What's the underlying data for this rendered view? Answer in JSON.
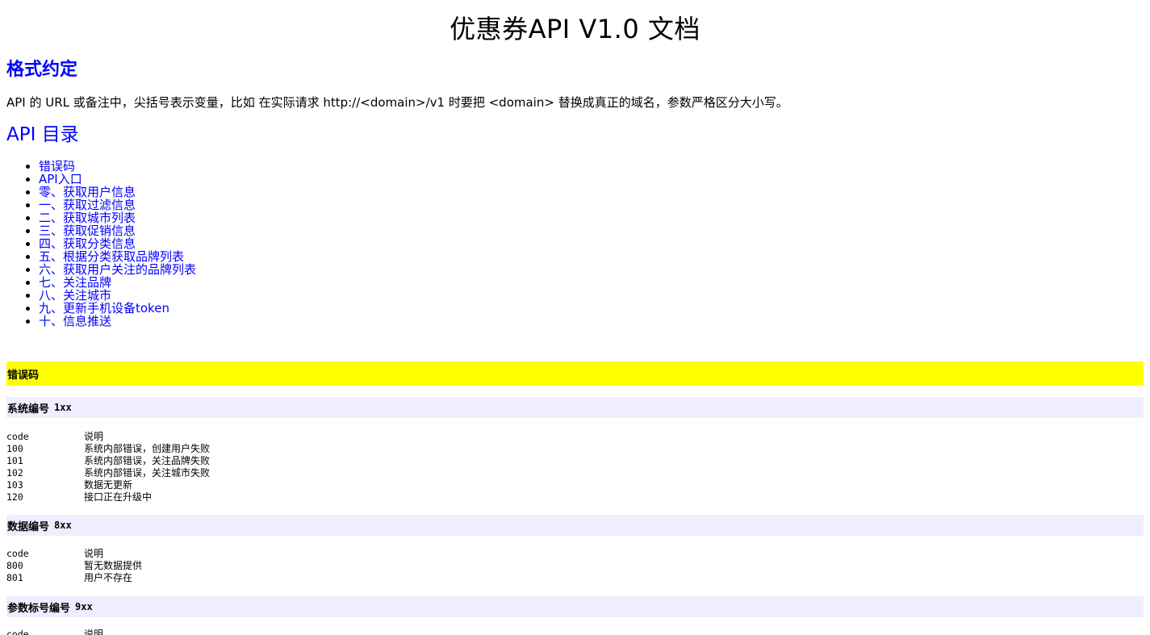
{
  "doc": {
    "title": "优惠券API V1.0 文档"
  },
  "format": {
    "heading": "格式约定",
    "text": "API 的 URL 或备注中，尖括号表示变量，比如 在实际请求 http://<domain>/v1 时要把 <domain> 替换成真正的域名，参数严格区分大小写。"
  },
  "toc": {
    "heading": "API 目录",
    "items": [
      "错误码",
      "API入口",
      "零、获取用户信息",
      "一、获取过滤信息",
      "二、获取城市列表",
      "三、获取促销信息",
      "四、获取分类信息",
      "五、根据分类获取品牌列表",
      "六、获取用户关注的品牌列表",
      "七、关注品牌",
      "八、关注城市",
      "九、更新手机设备token",
      "十、信息推送"
    ]
  },
  "errors": {
    "heading": "错误码",
    "groups": [
      {
        "label": "系统编号",
        "code": "1xx",
        "header": [
          "code",
          "说明"
        ],
        "rows": [
          [
            "100",
            "系统内部错误，创建用户失败"
          ],
          [
            "101",
            "系统内部错误，关注品牌失败"
          ],
          [
            "102",
            "系统内部错误，关注城市失败"
          ],
          [
            "103",
            "数据无更新"
          ],
          [
            "120",
            "接口正在升级中"
          ]
        ]
      },
      {
        "label": "数据编号",
        "code": "8xx",
        "header": [
          "code",
          "说明"
        ],
        "rows": [
          [
            "800",
            "暂无数据提供"
          ],
          [
            "801",
            "用户不存在"
          ]
        ]
      },
      {
        "label": "参数标号编号",
        "code": "9xx",
        "header": [
          "code",
          "说明"
        ],
        "rows": []
      }
    ]
  },
  "colors": {
    "link": "#0000ff",
    "highlight": "#ffff00",
    "subheader_bg": "#eeeeff"
  }
}
